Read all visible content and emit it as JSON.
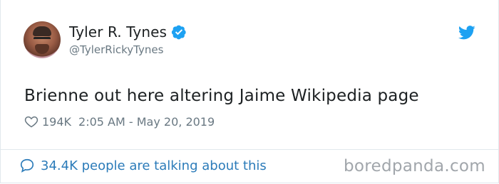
{
  "author": {
    "display_name": "Tyler R. Tynes",
    "handle": "@TylerRickyTynes",
    "avatar_icon": "avatar-photo",
    "verified_icon": "verified-badge-icon"
  },
  "tweet": {
    "text": "Brienne out here altering Jaime Wikipedia page",
    "likes": "194K",
    "timestamp": "2:05 AM - May 20, 2019"
  },
  "footer": {
    "conversation_text": "34.4K people are talking about this"
  },
  "watermark": "boredpanda.com",
  "colors": {
    "accent": "#1da1f2",
    "link": "#2b7bb9",
    "muted": "#697882",
    "text": "#1c2022",
    "border": "#e1e8ed"
  }
}
